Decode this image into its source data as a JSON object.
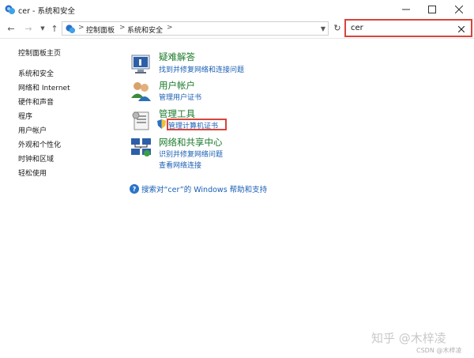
{
  "window": {
    "title": "cer - 系统和安全",
    "minimize_icon": "minimize-icon",
    "maximize_icon": "maximize-icon",
    "close_icon": "close-icon"
  },
  "address_bar": {
    "breadcrumbs": [
      "控制面板",
      "系统和安全"
    ],
    "separator": ">"
  },
  "search": {
    "value": "cer",
    "clear_icon": "close-icon"
  },
  "sidebar": {
    "items": [
      {
        "label": "控制面板主页"
      },
      {
        "label": "系统和安全"
      },
      {
        "label": "网络和 Internet"
      },
      {
        "label": "硬件和声音"
      },
      {
        "label": "程序"
      },
      {
        "label": "用户帐户"
      },
      {
        "label": "外观和个性化"
      },
      {
        "label": "时钟和区域"
      },
      {
        "label": "轻松使用"
      }
    ]
  },
  "categories": [
    {
      "title": "疑难解答",
      "links": [
        "找到并修复网络和连接问题"
      ],
      "icon": "troubleshooting-icon"
    },
    {
      "title": "用户帐户",
      "links": [
        "管理用户证书"
      ],
      "icon": "user-accounts-icon"
    },
    {
      "title": "管理工具",
      "links": [
        "管理计算机证书"
      ],
      "icon": "admin-tools-icon"
    },
    {
      "title": "网络和共享中心",
      "links": [
        "识别并修复网络问题",
        "查看网络连接"
      ],
      "icon": "network-icon"
    }
  ],
  "help": {
    "text": "搜索对“cer”的 Windows 帮助和支持"
  },
  "watermark": {
    "main": "知乎 @木梓凌",
    "sub": "CSDN @木梓凌"
  },
  "colors": {
    "accent_red": "#d9443a",
    "category_green": "#1a7a2a",
    "link_blue": "#1a5fb4"
  }
}
